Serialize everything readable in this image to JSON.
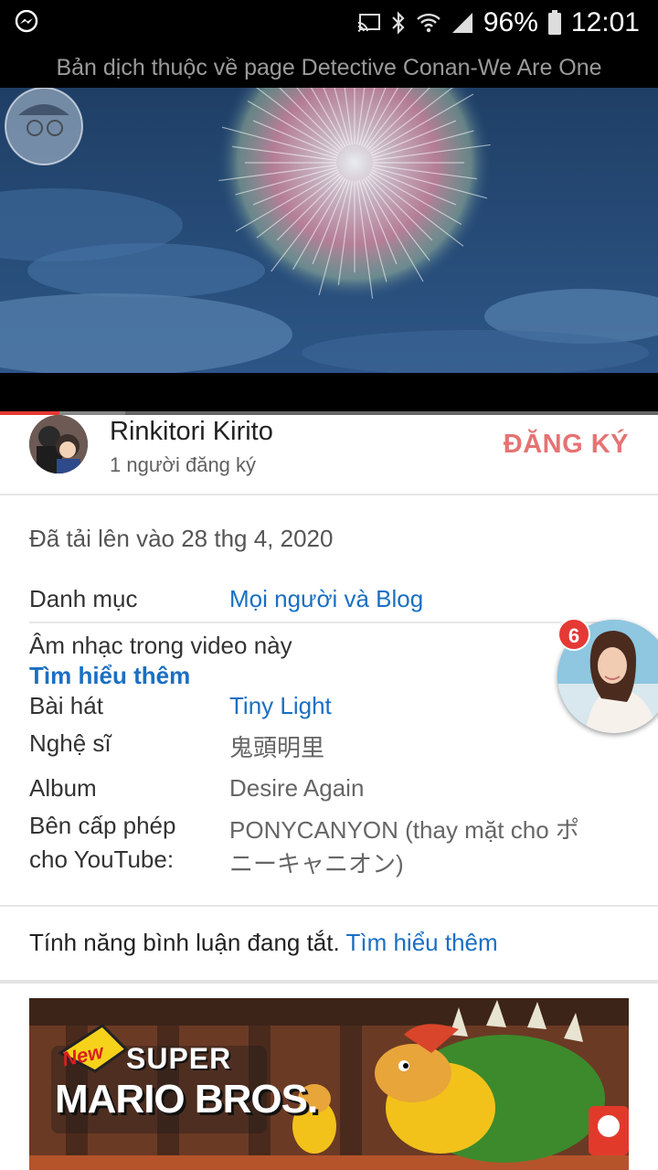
{
  "status_bar": {
    "battery": "96%",
    "time": "12:01",
    "icons": [
      "messenger-icon",
      "cast-icon",
      "bluetooth-icon",
      "wifi-icon",
      "signal-icon",
      "battery-icon"
    ]
  },
  "video": {
    "title": "Bản dịch thuộc về page Detective Conan-We Are One",
    "progress": 0.09,
    "buffered": 0.19
  },
  "channel": {
    "name": "Rinkitori Kirito",
    "subscribers": "1 người đăng ký",
    "subscribe_label": "ĐĂNG KÝ"
  },
  "details": {
    "uploaded": "Đã tải lên vào 28 thg 4, 2020",
    "category_label": "Danh mục",
    "category_value": "Mọi người và Blog",
    "music_heading": "Âm nhạc trong video này",
    "learn_more": "Tìm hiểu thêm",
    "song_label": "Bài hát",
    "song_value": "Tiny Light",
    "artist_label": "Nghệ sĩ",
    "artist_value": "鬼頭明里",
    "album_label": "Album",
    "album_value": "Desire Again",
    "licensor_label_1": "Bên cấp phép",
    "licensor_label_2": "cho YouTube:",
    "licensor_value_1": "PONYCANYON (thay mặt cho ポ",
    "licensor_value_2": "ニーキャニオン)"
  },
  "comments": {
    "text": "Tính năng bình luận đang tắt.",
    "link": "Tìm hiểu thêm"
  },
  "chat_bubble": {
    "badge": "6"
  },
  "next_video": {
    "logo_new": "New",
    "logo_super": "SUPER",
    "logo_title": "MARIO BROS."
  },
  "colors": {
    "accent_red": "#e53935",
    "subscribe": "#e57373",
    "link_blue": "#1a6fc4"
  }
}
